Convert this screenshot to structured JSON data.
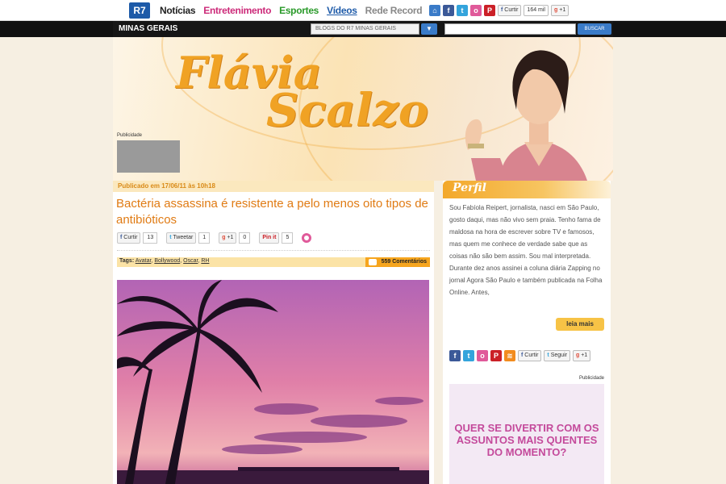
{
  "topnav": {
    "logo": "R7",
    "links": [
      "Notícias",
      "Entretenimento",
      "Esportes",
      "Vídeos",
      "Rede Record"
    ],
    "curtir": "Curtir",
    "curtir_count": "164 mil",
    "gplus": "+1"
  },
  "blackbar": {
    "region": "MINAS GERAIS",
    "blogs_select": "BLOGS DO R7 MINAS GERAIS",
    "search_button": "BUSCAR"
  },
  "header": {
    "title_line1": "Flávia",
    "title_line2": "Scalzo",
    "ad_label": "Publicidade"
  },
  "post": {
    "published": "Publicado em 17/06/11 às 10h18",
    "headline": "Bactéria assassina é resistente a pelo menos oito tipos de antibióticos",
    "share": {
      "curtir": "Curtir",
      "curtir_count": "13",
      "tweet": "Tweetar",
      "tweet_count": "1",
      "gplus": "+1",
      "gplus_count": "0",
      "pin": "Pin it",
      "pin_count": "5"
    },
    "tags_label": "Tags:",
    "tags": [
      "Avatar",
      "Bollywood",
      "Oscar",
      "RH"
    ],
    "comments": "559 Comentários"
  },
  "sidebar": {
    "title": "Perfil",
    "bio": "Sou Fabíola Reipert, jornalista, nasci em São Paulo, gosto daqui, mas não vivo sem praia. Tenho fama de maldosa na hora de escrever sobre TV e famosos, mas quem me conhece de verdade sabe que as coisas não são bem assim. Sou mal interpretada. Durante dez anos assinei a coluna diária Zapping no jornal Agora São Paulo e também publicada na Folha Online. Antes,",
    "read_more": "leia mais",
    "curtir": "Curtir",
    "seguir": "Seguir",
    "gplus": "+1",
    "ad_label": "Publicidade",
    "ad_text": "QUER SE DIVERTIR COM OS ASSUNTOS MAIS QUENTES DO MOMENTO?"
  },
  "colors": {
    "accent_orange": "#e07b14",
    "r7_blue": "#1d5aa8",
    "entretenimento": "#cc2a79",
    "esportes": "#2a9a2a"
  }
}
